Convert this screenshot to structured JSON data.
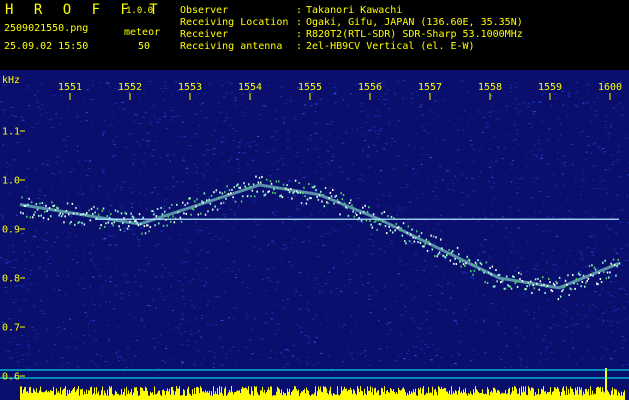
{
  "header": {
    "app_title": "H R O F F T",
    "version": "1.0.0",
    "filename": "2509021550.png",
    "timestamp": "25.09.02 15:50",
    "meteor_label": "meteor",
    "meteor_count": "50",
    "info": [
      {
        "label": "Observer",
        "value": "Takanori Kawachi"
      },
      {
        "label": "Receiving Location",
        "value": "Ogaki, Gifu, JAPAN (136.60E, 35.35N)"
      },
      {
        "label": "Receiver",
        "value": "R820T2(RTL-SDR) SDR-Sharp 53.1000MHz"
      },
      {
        "label": "Receiving antenna",
        "value": "2el-HB9CV Vertical (el. E-W)"
      }
    ]
  },
  "chart_data": {
    "type": "heatmap",
    "ylabel": "kHz",
    "x_ticks": [
      "1551",
      "1552",
      "1553",
      "1554",
      "1555",
      "1556",
      "1557",
      "1558",
      "1559",
      "1600"
    ],
    "y_ticks": [
      "1.1",
      "1.0",
      "0.9",
      "0.8",
      "0.7",
      "0.6"
    ],
    "ylim": [
      0.58,
      1.2
    ],
    "carrier_khz": 0.92,
    "doppler_trace": [
      {
        "t": "15:50:00",
        "khz": 0.95
      },
      {
        "t": "15:51:00",
        "khz": 0.93
      },
      {
        "t": "15:52:00",
        "khz": 0.91
      },
      {
        "t": "15:53:00",
        "khz": 0.95
      },
      {
        "t": "15:54:00",
        "khz": 0.99
      },
      {
        "t": "15:55:00",
        "khz": 0.97
      },
      {
        "t": "15:56:00",
        "khz": 0.92
      },
      {
        "t": "15:57:00",
        "khz": 0.86
      },
      {
        "t": "15:58:00",
        "khz": 0.8
      },
      {
        "t": "15:59:00",
        "khz": 0.78
      },
      {
        "t": "16:00:00",
        "khz": 0.83
      }
    ],
    "colors": {
      "background": "#0a0f6e",
      "noise": "#1d3bd1",
      "signal": "#9dffd9",
      "carrier": "#b0e8ff",
      "axis": "#ffff00",
      "meteor_bar": "#ffff00",
      "baseline": "#00ffff"
    }
  }
}
